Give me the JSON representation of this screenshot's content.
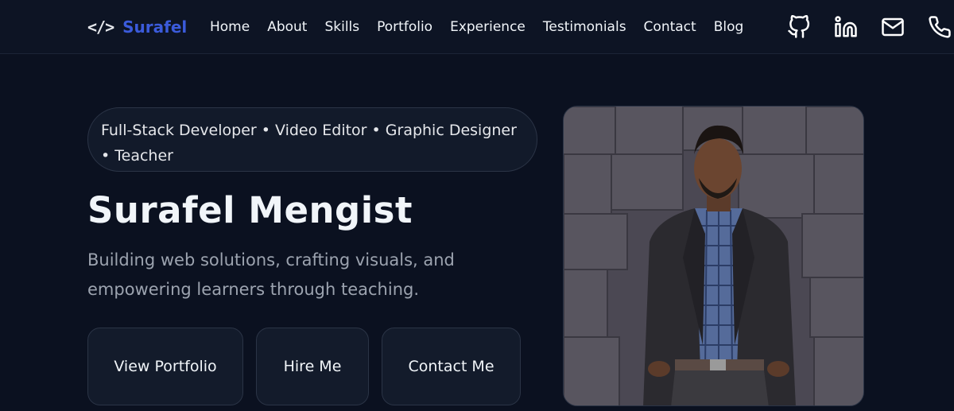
{
  "brand": {
    "icon": "</>",
    "name": "Surafel"
  },
  "nav": {
    "links": [
      "Home",
      "About",
      "Skills",
      "Portfolio",
      "Experience",
      "Testimonials",
      "Contact",
      "Blog"
    ],
    "icons": [
      "github-icon",
      "linkedin-icon",
      "mail-icon",
      "phone-icon"
    ]
  },
  "hero": {
    "tagline": "Full-Stack Developer • Video Editor • Graphic Designer • Teacher",
    "title": "Surafel Mengist",
    "subtitle": "Building web solutions, crafting visuals, and empowering learners through teaching.",
    "buttons": {
      "portfolio": "View Portfolio",
      "hire": "Hire Me",
      "contact": "Contact Me"
    }
  },
  "colors": {
    "background": "#0b1120",
    "navbar": "#0d1424",
    "accent": "#3b5bdb",
    "muted_text": "#9ca3af"
  }
}
